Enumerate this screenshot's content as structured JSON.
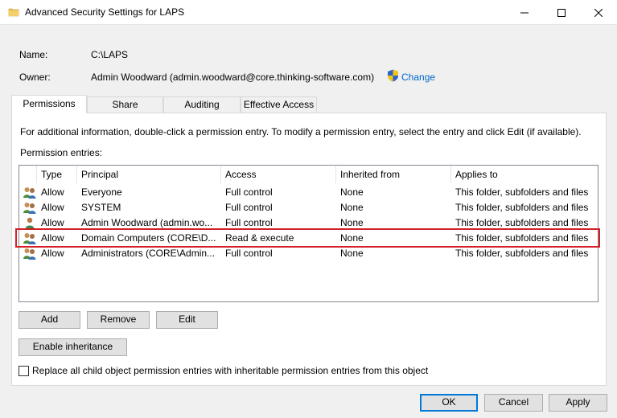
{
  "window": {
    "title": "Advanced Security Settings for LAPS"
  },
  "object": {
    "name_label": "Name:",
    "name_value": "C:\\LAPS",
    "owner_label": "Owner:",
    "owner_value": "Admin Woodward (admin.woodward@core.thinking-software.com)",
    "change_label": "Change"
  },
  "tabs": [
    {
      "label": "Permissions",
      "active": true
    },
    {
      "label": "Share",
      "active": false
    },
    {
      "label": "Auditing",
      "active": false
    },
    {
      "label": "Effective Access",
      "active": false
    }
  ],
  "permissions": {
    "info_text": "For additional information, double-click a permission entry. To modify a permission entry, select the entry and click Edit (if available).",
    "entries_label": "Permission entries:",
    "columns": [
      "Type",
      "Principal",
      "Access",
      "Inherited from",
      "Applies to"
    ],
    "rows": [
      {
        "icon": "group-icon",
        "type": "Allow",
        "principal": "Everyone",
        "access": "Full control",
        "inherited": "None",
        "applies": "This folder, subfolders and files"
      },
      {
        "icon": "group-icon",
        "type": "Allow",
        "principal": "SYSTEM",
        "access": "Full control",
        "inherited": "None",
        "applies": "This folder, subfolders and files"
      },
      {
        "icon": "user-icon",
        "type": "Allow",
        "principal": "Admin Woodward (admin.wo...",
        "access": "Full control",
        "inherited": "None",
        "applies": "This folder, subfolders and files"
      },
      {
        "icon": "group-icon",
        "type": "Allow",
        "principal": "Domain Computers (CORE\\D...",
        "access": "Read & execute",
        "inherited": "None",
        "applies": "This folder, subfolders and files"
      },
      {
        "icon": "group-icon",
        "type": "Allow",
        "principal": "Administrators (CORE\\Admin...",
        "access": "Full control",
        "inherited": "None",
        "applies": "This folder, subfolders and files"
      }
    ],
    "highlighted_row": 3,
    "add_label": "Add",
    "remove_label": "Remove",
    "edit_label": "Edit",
    "enable_inheritance_label": "Enable inheritance",
    "replace_label": "Replace all child object permission entries with inheritable permission entries from this object",
    "replace_checked": false
  },
  "footer": {
    "ok_label": "OK",
    "cancel_label": "Cancel",
    "apply_label": "Apply"
  },
  "colors": {
    "highlight_border": "#d41f26",
    "link": "#0066cc",
    "default_button_border": "#0078d7"
  }
}
